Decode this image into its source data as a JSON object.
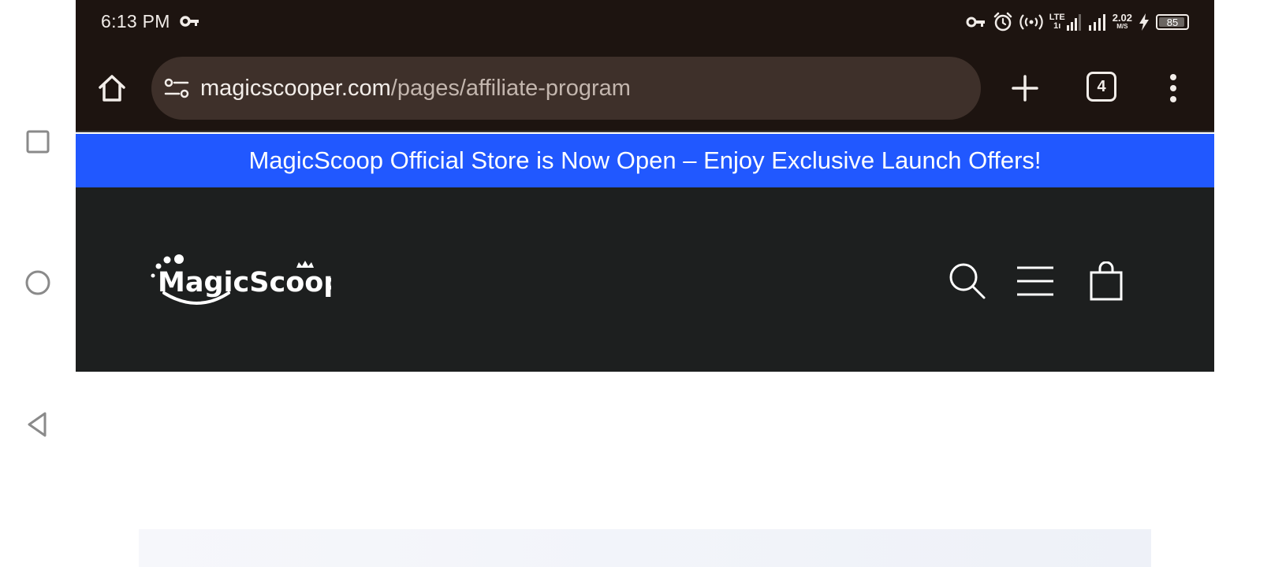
{
  "status_bar": {
    "time": "6:13 PM",
    "network_label": "LTE",
    "network_sub": "1ı",
    "speed_value": "2.02",
    "speed_unit": "M/S",
    "battery_level": "85"
  },
  "browser": {
    "url_host": "magicscooper.com",
    "url_path": "/pages/affiliate-program",
    "tab_count": "4"
  },
  "announcement": {
    "text": "MagicScoop Official Store is Now Open – Enjoy Exclusive Launch Offers!"
  },
  "site": {
    "logo_text": "MagicScoop"
  },
  "colors": {
    "status_bg": "#1d1410",
    "omnibox_bg": "#3e302a",
    "announcement_bg": "#2158ff",
    "header_bg": "#1d1f1f"
  },
  "icons": {
    "nav_square": "recent-apps-icon",
    "nav_circle": "home-nav-icon",
    "nav_back": "back-icon",
    "header": [
      "search-icon",
      "hamburger-menu-icon",
      "shopping-bag-icon"
    ]
  }
}
